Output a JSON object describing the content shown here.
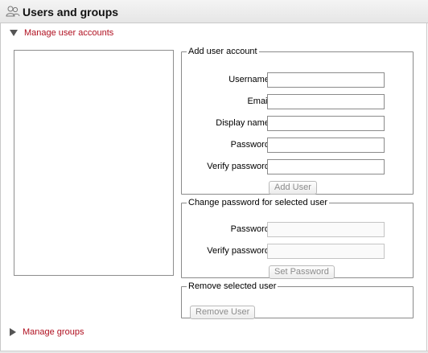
{
  "header": {
    "title": "Users and groups",
    "icon": "users-icon"
  },
  "sections": {
    "manage_accounts": "Manage user accounts",
    "manage_groups": "Manage groups"
  },
  "add_user": {
    "legend": "Add user account",
    "username_label": "Username:",
    "username_value": "",
    "email_label": "Email:",
    "email_value": "",
    "display_name_label": "Display name:",
    "display_name_value": "",
    "password_label": "Password:",
    "password_value": "",
    "verify_label": "Verify password:",
    "verify_value": "",
    "button": "Add User"
  },
  "change_password": {
    "legend": "Change password for selected user",
    "password_label": "Password:",
    "password_value": "",
    "verify_label": "Verify password:",
    "verify_value": "",
    "button": "Set Password"
  },
  "remove_user": {
    "legend": "Remove selected user",
    "button": "Remove User"
  },
  "user_list": {
    "items": []
  }
}
